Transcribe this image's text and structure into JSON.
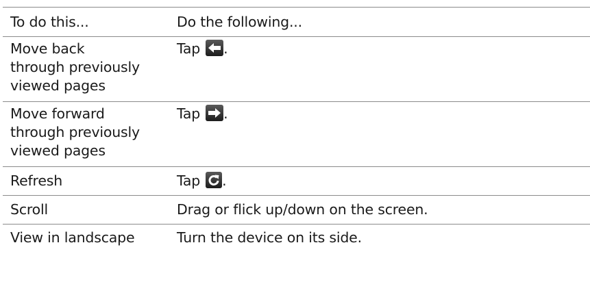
{
  "table": {
    "headers": {
      "col1": "To do this...",
      "col2": "Do the following..."
    },
    "rows": {
      "back": {
        "action_lines": [
          "Move back",
          "through previously",
          "viewed pages"
        ],
        "instruction": "Tap",
        "icon": "back-arrow-icon",
        "suffix": "."
      },
      "forward": {
        "action_lines": [
          "Move forward",
          "through previously",
          "viewed pages"
        ],
        "instruction": "Tap",
        "icon": "forward-arrow-icon",
        "suffix": "."
      },
      "refresh": {
        "action": "Refresh",
        "instruction": "Tap",
        "icon": "refresh-icon",
        "suffix": "."
      },
      "scroll": {
        "action": "Scroll",
        "instruction": "Drag or flick up/down on the screen."
      },
      "landscape": {
        "action": "View in landscape",
        "instruction": "Turn the device on its side."
      }
    }
  }
}
